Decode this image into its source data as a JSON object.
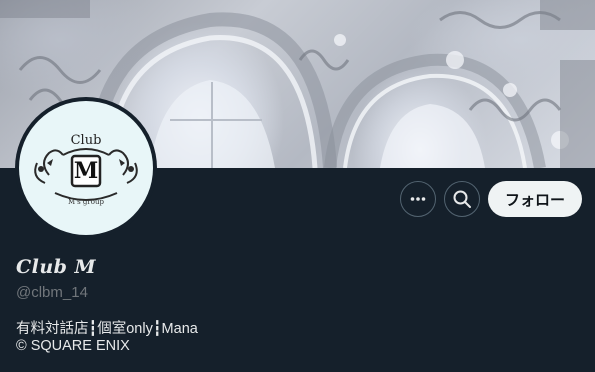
{
  "colors": {
    "background": "#15202b",
    "text_primary": "#e7e9ea",
    "text_secondary": "#71767b",
    "button_border": "#536471",
    "follow_bg": "#eff3f4",
    "avatar_bg": "#e8f6f8"
  },
  "avatar": {
    "logo_club_text": "Club",
    "logo_letter": "M",
    "logo_group_text": "M's group"
  },
  "actions": {
    "more_icon": "more-horizontal-icon",
    "search_icon": "search-icon",
    "follow_label": "フォロー"
  },
  "profile": {
    "display_name": "Club M",
    "handle": "@clbm_14",
    "bio_line1": "有料対話店┇個室only┇Mana",
    "bio_line2": "© SQUARE ENIX"
  }
}
